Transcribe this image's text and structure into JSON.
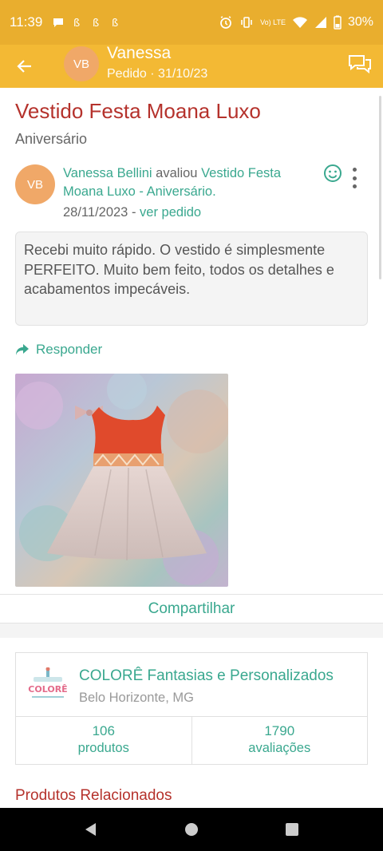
{
  "status_bar": {
    "time": "11:39",
    "battery": "30%",
    "notification_icons": [
      "chat-bubble-icon",
      "app-icon",
      "app-icon",
      "app-icon"
    ],
    "volte_label": "Vo) LTE"
  },
  "app_bar": {
    "avatar_initials": "VB",
    "name": "Vanessa",
    "subtitle": "Pedido · 31/10/23"
  },
  "product": {
    "title": "Vestido Festa Moana Luxo",
    "variant": "Aniversário"
  },
  "review": {
    "avatar_initials": "VB",
    "author": "Vanessa Bellini",
    "action": " avaliou ",
    "product_ref": "Vestido Festa Moana Luxo - Aniversário.",
    "date": "28/11/2023",
    "separator": " - ",
    "order_link": "ver pedido",
    "text": "Recebi muito rápido. O vestido é simplesmente PERFEITO. Muito bem feito, todos os detalhes e acabamentos impecáveis.",
    "reply_label": "Responder"
  },
  "share_label": "Compartilhar",
  "store": {
    "name": "COLORÊ Fantasias e Personalizados",
    "city": "Belo Horizonte, MG",
    "logo_text": "COLORÊ",
    "products_count": "106",
    "products_label": "produtos",
    "reviews_count": "1790",
    "reviews_label": "avaliações"
  },
  "related_title": "Produtos Relacionados",
  "colors": {
    "status_bar": "#e9ae2e",
    "app_bar": "#f3b934",
    "accent_green": "#3aa88f",
    "title_red": "#b5322c",
    "avatar": "#f0a868"
  }
}
